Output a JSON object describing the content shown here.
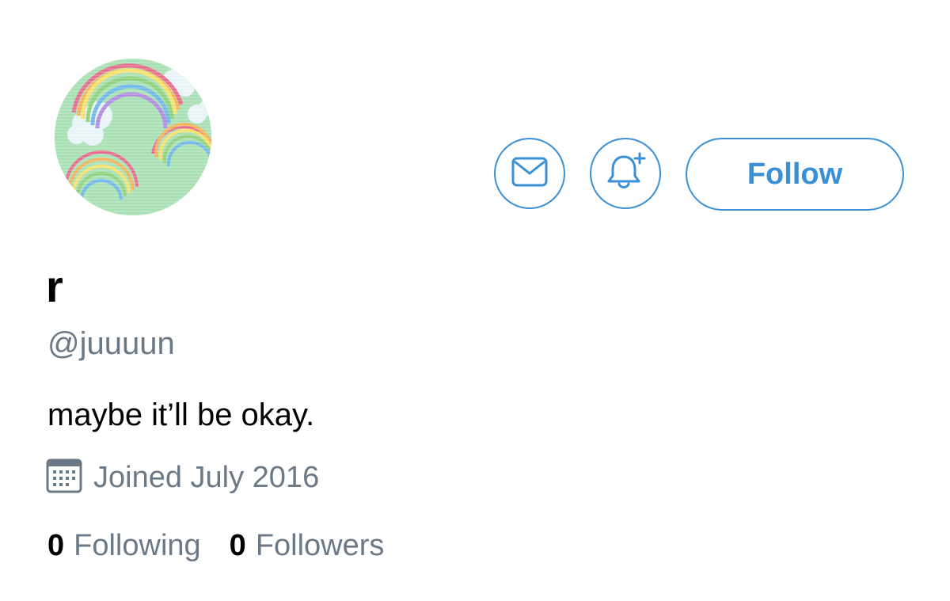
{
  "profile": {
    "display_name": "r",
    "handle": "@juuuun",
    "bio": "maybe it’ll be okay.",
    "joined": "Joined July 2016",
    "avatar": {
      "description_icon": "rainbow-cloud-avatar"
    }
  },
  "actions": {
    "message_icon": "envelope-icon",
    "notify_icon": "bell-plus-icon",
    "follow_label": "Follow"
  },
  "stats": {
    "following_count": "0",
    "following_label": "Following",
    "followers_count": "0",
    "followers_label": "Followers"
  },
  "colors": {
    "accent": "#3a8fd6",
    "secondary_text": "#6b7987",
    "primary_text": "#000000",
    "avatar_bg": "#a8dfb3"
  }
}
